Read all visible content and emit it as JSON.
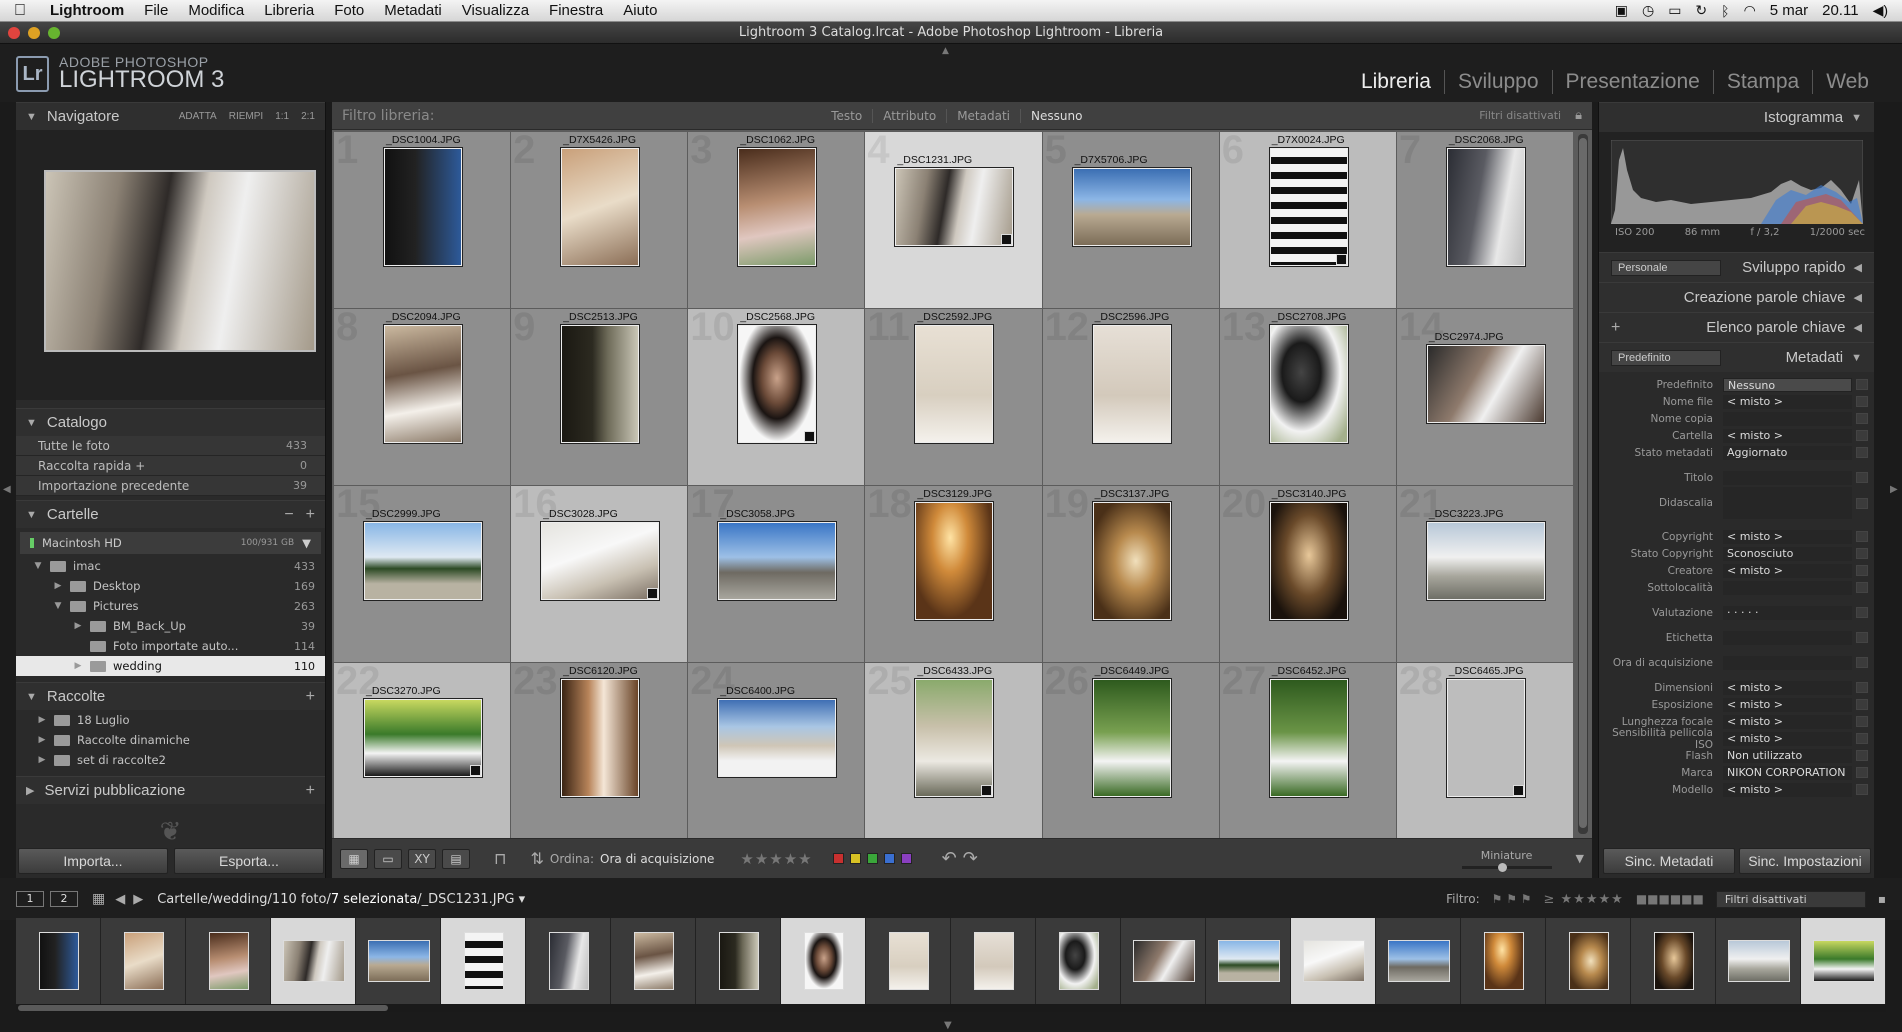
{
  "menubar": {
    "app": "Lightroom",
    "items": [
      "File",
      "Modifica",
      "Libreria",
      "Foto",
      "Metadati",
      "Visualizza",
      "Finestra",
      "Aiuto"
    ],
    "date": "5 mar",
    "time": "20.11"
  },
  "window": {
    "title": "Lightroom 3 Catalog.lrcat - Adobe Photoshop Lightroom - Libreria"
  },
  "logo": {
    "mark": "Lr",
    "line1": "ADOBE PHOTOSHOP",
    "line2": "LIGHTROOM 3"
  },
  "modules": [
    {
      "label": "Libreria",
      "active": true
    },
    {
      "label": "Sviluppo"
    },
    {
      "label": "Presentazione"
    },
    {
      "label": "Stampa"
    },
    {
      "label": "Web"
    }
  ],
  "navigator": {
    "title": "Navigatore",
    "options": [
      "ADATTA",
      "RIEMPI",
      "1:1",
      "2:1"
    ]
  },
  "catalog": {
    "title": "Catalogo",
    "items": [
      {
        "label": "Tutte le foto",
        "count": "433"
      },
      {
        "label": "Raccolta rapida +",
        "count": "0"
      },
      {
        "label": "Importazione precedente",
        "count": "39"
      }
    ]
  },
  "folders": {
    "title": "Cartelle",
    "disk": {
      "name": "Macintosh HD",
      "size": "100/931 GB"
    },
    "items": [
      {
        "label": "imac",
        "count": "433"
      },
      {
        "label": "Desktop",
        "count": "169"
      },
      {
        "label": "Pictures",
        "count": "263"
      },
      {
        "label": "BM_Back_Up",
        "count": "39"
      },
      {
        "label": "Foto importate auto...",
        "count": "114"
      },
      {
        "label": "wedding",
        "count": "110"
      }
    ]
  },
  "collections": {
    "title": "Raccolte",
    "items": [
      {
        "label": "18 Luglio"
      },
      {
        "label": "Raccolte dinamiche"
      },
      {
        "label": "set di raccolte2"
      }
    ]
  },
  "publish": {
    "title": "Servizi pubblicazione"
  },
  "left_buttons": {
    "import": "Importa...",
    "export": "Esporta..."
  },
  "filterbar": {
    "label": "Filtro libreria:",
    "options": [
      "Testo",
      "Attributo",
      "Metadati",
      "Nessuno"
    ],
    "active": "Nessuno",
    "status": "Filtri disattivati"
  },
  "grid": {
    "cells": [
      {
        "n": "1",
        "name": "_DSC1004.JPG"
      },
      {
        "n": "2",
        "name": "_D7X5426.JPG"
      },
      {
        "n": "3",
        "name": "_DSC1062.JPG"
      },
      {
        "n": "4",
        "name": "_DSC1231.JPG"
      },
      {
        "n": "5",
        "name": "_D7X5706.JPG"
      },
      {
        "n": "6",
        "name": "_D7X0024.JPG"
      },
      {
        "n": "7",
        "name": "_DSC2068.JPG"
      },
      {
        "n": "8",
        "name": "_DSC2094.JPG"
      },
      {
        "n": "9",
        "name": "_DSC2513.JPG"
      },
      {
        "n": "10",
        "name": "_DSC2568.JPG"
      },
      {
        "n": "11",
        "name": "_DSC2592.JPG"
      },
      {
        "n": "12",
        "name": "_DSC2596.JPG"
      },
      {
        "n": "13",
        "name": "_DSC2708.JPG"
      },
      {
        "n": "14",
        "name": "_DSC2974.JPG"
      },
      {
        "n": "15",
        "name": "_DSC2999.JPG"
      },
      {
        "n": "16",
        "name": "_DSC3028.JPG"
      },
      {
        "n": "17",
        "name": "_DSC3058.JPG"
      },
      {
        "n": "18",
        "name": "_DSC3129.JPG"
      },
      {
        "n": "19",
        "name": "_DSC3137.JPG"
      },
      {
        "n": "20",
        "name": "_DSC3140.JPG"
      },
      {
        "n": "21",
        "name": "_DSC3223.JPG"
      },
      {
        "n": "22",
        "name": "_DSC3270.JPG"
      },
      {
        "n": "23",
        "name": "_DSC6120.JPG"
      },
      {
        "n": "24",
        "name": "_DSC6400.JPG"
      },
      {
        "n": "25",
        "name": "_DSC6433.JPG"
      },
      {
        "n": "26",
        "name": "_DSC6449.JPG"
      },
      {
        "n": "27",
        "name": "_DSC6452.JPG"
      },
      {
        "n": "28",
        "name": "_DSC6465.JPG"
      }
    ]
  },
  "toolbar": {
    "sort_label": "Ordina:",
    "sort_value": "Ora di acquisizione",
    "thumbs_label": "Miniature",
    "stars": "★★★★★",
    "colors": [
      "#c8302f",
      "#d8c224",
      "#3aa63a",
      "#3a6fd0",
      "#8a3fc0"
    ]
  },
  "histogram": {
    "title": "Istogramma",
    "iso": "ISO 200",
    "focal": "86 mm",
    "aperture": "f / 3,2",
    "shutter": "1/2000 sec"
  },
  "quick_develop": {
    "title": "Sviluppo rapido",
    "preset": "Personale"
  },
  "keywording": {
    "title": "Creazione parole chiave"
  },
  "keyword_list": {
    "title": "Elenco parole chiave"
  },
  "metadata": {
    "title": "Metadati",
    "preset": "Predefinito",
    "rows": [
      {
        "k": "Predefinito",
        "v": "Nessuno"
      },
      {
        "k": "Nome file",
        "v": "< misto >"
      },
      {
        "k": "Nome copia",
        "v": ""
      },
      {
        "k": "Cartella",
        "v": "< misto >"
      },
      {
        "k": "Stato metadati",
        "v": "Aggiornato"
      },
      {
        "k": "Titolo",
        "v": ""
      },
      {
        "k": "Didascalia",
        "v": ""
      },
      {
        "k": "Copyright",
        "v": "< misto >"
      },
      {
        "k": "Stato Copyright",
        "v": "Sconosciuto"
      },
      {
        "k": "Creatore",
        "v": "< misto >"
      },
      {
        "k": "Sottolocalità",
        "v": ""
      },
      {
        "k": "Valutazione",
        "v": "· · · · ·"
      },
      {
        "k": "Etichetta",
        "v": ""
      },
      {
        "k": "Ora di acquisizione",
        "v": ""
      },
      {
        "k": "Dimensioni",
        "v": "< misto >"
      },
      {
        "k": "Esposizione",
        "v": "< misto >"
      },
      {
        "k": "Lunghezza focale",
        "v": "< misto >"
      },
      {
        "k": "Sensibilità pellicola ISO",
        "v": "< misto >"
      },
      {
        "k": "Flash",
        "v": "Non utilizzato"
      },
      {
        "k": "Marca",
        "v": "NIKON CORPORATION"
      },
      {
        "k": "Modello",
        "v": "< misto >"
      }
    ]
  },
  "right_buttons": {
    "sync_meta": "Sinc. Metadati",
    "sync_settings": "Sinc. Impostazioni"
  },
  "filmstrip": {
    "page1": "1",
    "page2": "2",
    "path_prefix": "Cartelle/wedding/110 foto/",
    "path_selected": "7 selezionata",
    "path_file": "/_DSC1231.JPG",
    "filter_label": "Filtro:",
    "filter_value": "Filtri disattivati"
  }
}
